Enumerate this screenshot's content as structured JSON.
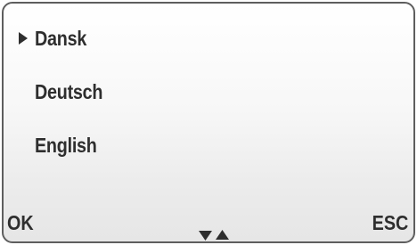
{
  "menu": {
    "items": [
      {
        "label": "Dansk",
        "selected": true
      },
      {
        "label": "Deutsch",
        "selected": false
      },
      {
        "label": "English",
        "selected": false
      }
    ],
    "pointer_icon": "triangle-right-icon"
  },
  "softkeys": {
    "left_label": "OK",
    "right_label": "ESC"
  },
  "navigation": {
    "down_icon": "triangle-down-icon",
    "up_icon": "triangle-up-icon"
  },
  "colors": {
    "text": "#2e2e2e",
    "border": "#5e5e5e",
    "background_top": "#ffffff",
    "background_bottom": "#e6e6e6"
  }
}
